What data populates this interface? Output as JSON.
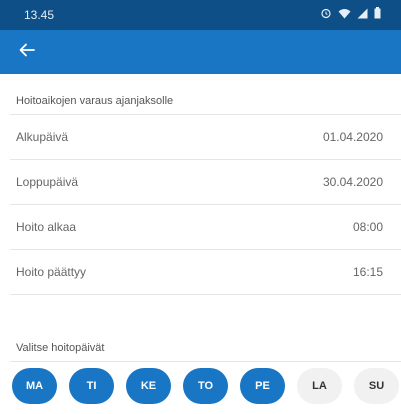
{
  "status_bar": {
    "time": "13.45",
    "icons": [
      "alarm-icon",
      "wifi-icon",
      "signal-icon",
      "battery-icon"
    ]
  },
  "app_bar": {
    "back_icon": "arrow-left-icon",
    "color": "#1976c4"
  },
  "section": {
    "title": "Hoitoaikojen varaus ajanjaksolle",
    "rows": [
      {
        "label": "Alkupäivä",
        "value": "01.04.2020"
      },
      {
        "label": "Loppupäivä",
        "value": "30.04.2020"
      },
      {
        "label": "Hoito alkaa",
        "value": "08:00"
      },
      {
        "label": "Hoito päättyy",
        "value": "16:15"
      }
    ]
  },
  "days": {
    "title": "Valitse hoitopäivät",
    "items": [
      {
        "label": "MA",
        "selected": true
      },
      {
        "label": "TI",
        "selected": true
      },
      {
        "label": "KE",
        "selected": true
      },
      {
        "label": "TO",
        "selected": true
      },
      {
        "label": "PE",
        "selected": true
      },
      {
        "label": "LA",
        "selected": false
      },
      {
        "label": "SU",
        "selected": false
      }
    ]
  }
}
